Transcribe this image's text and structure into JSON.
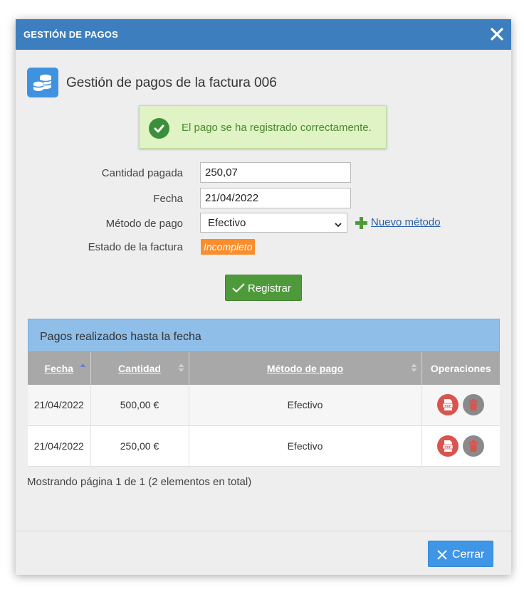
{
  "dialog": {
    "title": "GESTIÓN DE PAGOS",
    "close_icon": "close-icon",
    "heading": "Gestión de pagos de la factura 006",
    "heading_icon": "coins-icon"
  },
  "alert": {
    "message": "El pago se ha registrado correctamente.",
    "icon": "check-circle-icon"
  },
  "form": {
    "amount_label": "Cantidad pagada",
    "amount_value": "250,07",
    "date_label": "Fecha",
    "date_value": "21/04/2022",
    "method_label": "Método de pago",
    "method_value": "Efectivo",
    "new_method_label": "Nuevo método",
    "status_label": "Estado de la factura",
    "status_value": "Incompleto",
    "register_label": "Registrar"
  },
  "colors": {
    "titlebar": "#3d7ebf",
    "success": "#4e9a3b",
    "status_badge": "#fb8d2b",
    "primary": "#3f95e6"
  },
  "payments": {
    "panel_title": "Pagos realizados hasta la fecha",
    "columns": [
      "Fecha",
      "Cantidad",
      "Método de pago",
      "Operaciones"
    ],
    "rows": [
      {
        "date": "21/04/2022",
        "amount": "500,00 €",
        "method": "Efectivo"
      },
      {
        "date": "21/04/2022",
        "amount": "250,00 €",
        "method": "Efectivo"
      }
    ],
    "pager": "Mostrando página 1 de 1 (2 elementos en total)"
  },
  "footer": {
    "close_label": "Cerrar"
  }
}
